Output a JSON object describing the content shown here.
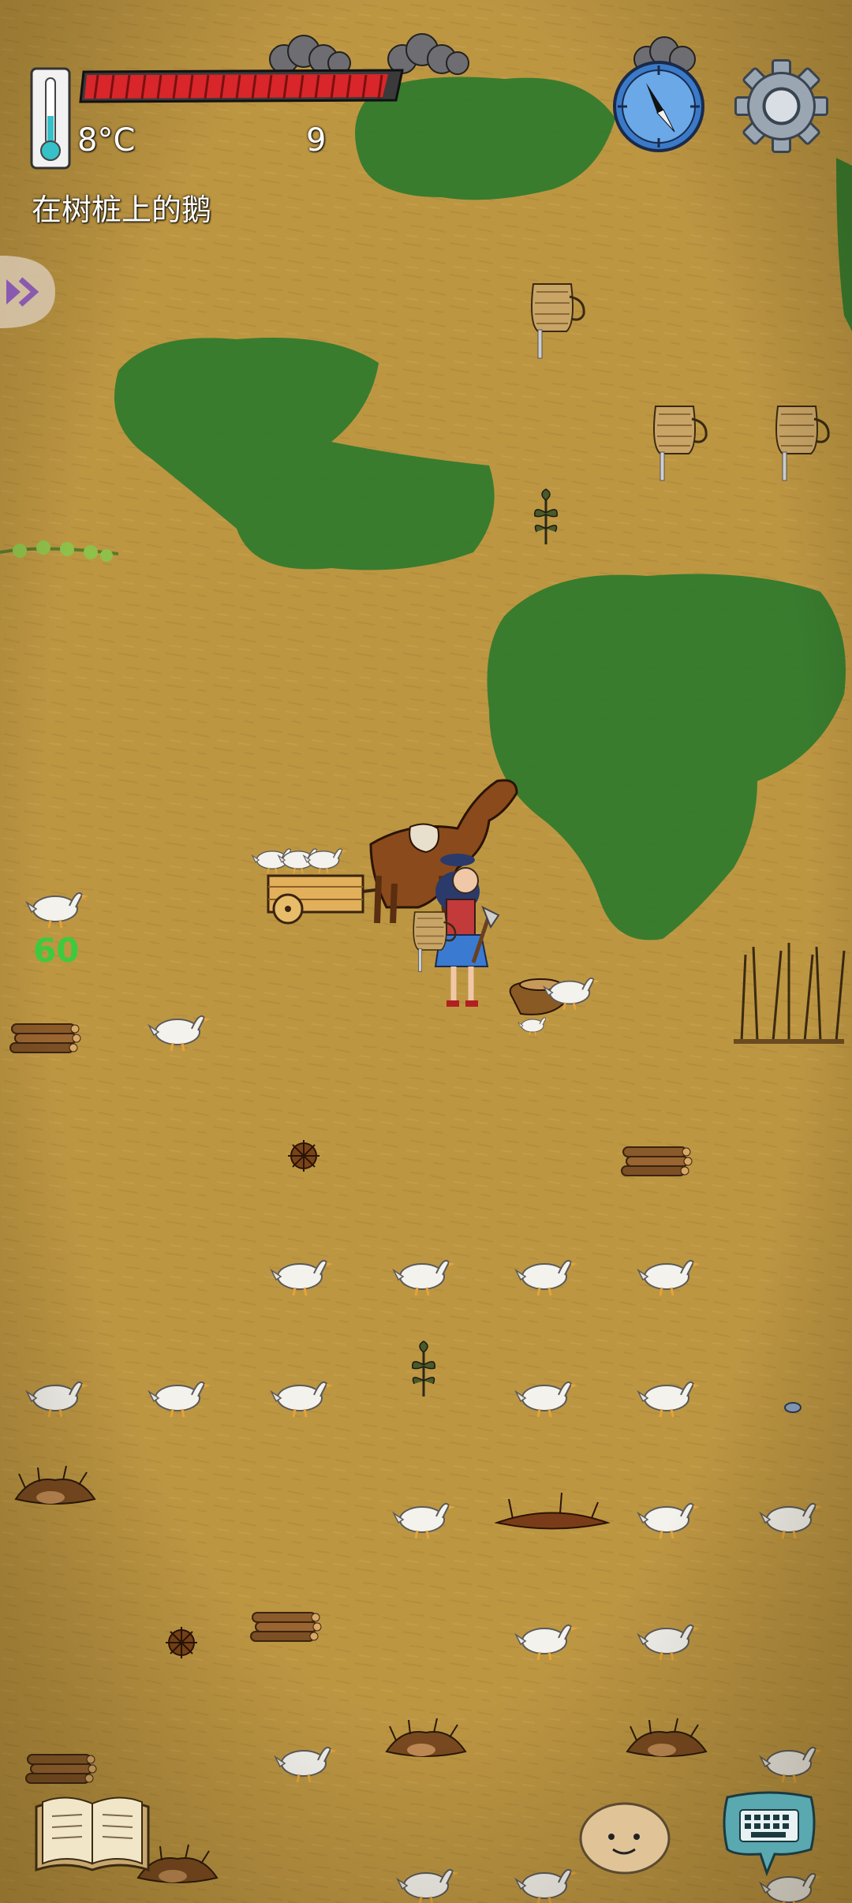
{
  "hud": {
    "temperature": "8°C",
    "food_count": "9",
    "hover_label": "在树桩上的鹅",
    "floating_number": "60"
  },
  "colors": {
    "ground": "#b8923e",
    "grass_patch": "#2e7a2c",
    "health_bar": "#d8262b",
    "floating_number": "#3fc93f"
  },
  "icons": {
    "thermometer": "thermometer-icon",
    "compass": "compass-icon",
    "settings": "gear-icon",
    "expand_panel": "expand-arrows-icon",
    "recipe_book": "book-icon",
    "emote": "face-icon",
    "chat": "keyboard-icon"
  }
}
